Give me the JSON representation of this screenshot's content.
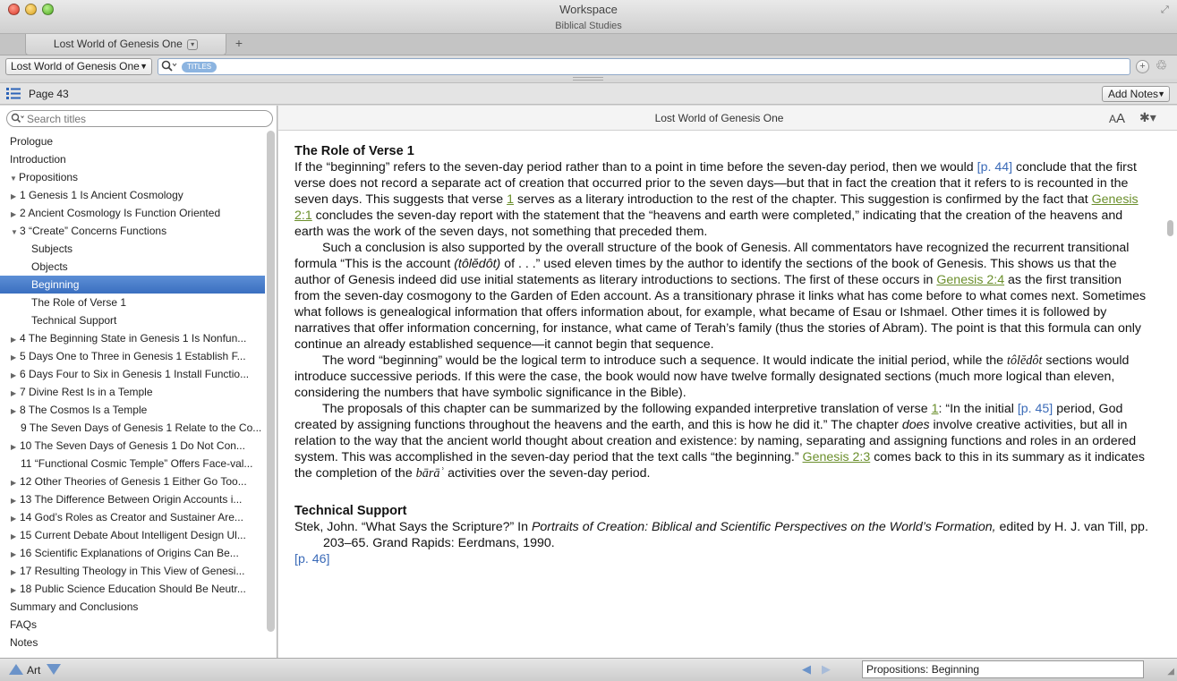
{
  "window": {
    "title": "Workspace",
    "subtitle": "Biblical Studies"
  },
  "tabs": [
    {
      "label": "Lost World of Genesis One"
    }
  ],
  "toolbar": {
    "resource": "Lost World of Genesis One",
    "search_scope": "TITLES",
    "search_value": ""
  },
  "pagebar": {
    "page": "Page 43",
    "add_notes": "Add Notes"
  },
  "sidebar": {
    "search_placeholder": "Search titles",
    "items": [
      {
        "label": "Prologue",
        "level": 0,
        "expander": ""
      },
      {
        "label": "Introduction",
        "level": 0,
        "expander": ""
      },
      {
        "label": "Propositions",
        "level": 0,
        "expander": "open"
      },
      {
        "label": "1 Genesis 1 Is Ancient Cosmology",
        "level": 1,
        "expander": "closed"
      },
      {
        "label": "2 Ancient Cosmology Is Function Oriented",
        "level": 1,
        "expander": "closed"
      },
      {
        "label": "3 “Create” Concerns Functions",
        "level": 1,
        "expander": "open"
      },
      {
        "label": "Subjects",
        "level": 2,
        "expander": ""
      },
      {
        "label": "Objects",
        "level": 2,
        "expander": ""
      },
      {
        "label": "Beginning",
        "level": 2,
        "expander": "",
        "selected": true
      },
      {
        "label": "The Role of Verse 1",
        "level": 2,
        "expander": ""
      },
      {
        "label": "Technical Support",
        "level": 2,
        "expander": ""
      },
      {
        "label": "4 The Beginning State in Genesis 1 Is Nonfun...",
        "level": 1,
        "expander": "closed"
      },
      {
        "label": "5 Days One to Three in Genesis 1 Establish F...",
        "level": 1,
        "expander": "closed"
      },
      {
        "label": "6 Days Four to Six in Genesis 1 Install Functio...",
        "level": 1,
        "expander": "closed"
      },
      {
        "label": "7 Divine Rest Is in a Temple",
        "level": 1,
        "expander": "closed"
      },
      {
        "label": "8 The Cosmos Is a Temple",
        "level": 1,
        "expander": "closed"
      },
      {
        "label": "9 The Seven Days of Genesis 1 Relate to the Co...",
        "level": 1,
        "expander": "none"
      },
      {
        "label": "10 The Seven Days of Genesis 1 Do Not Con...",
        "level": 1,
        "expander": "closed"
      },
      {
        "label": "11 “Functional Cosmic Temple” Offers Face-val...",
        "level": 1,
        "expander": "none"
      },
      {
        "label": "12 Other Theories of Genesis 1 Either Go Too...",
        "level": 1,
        "expander": "closed"
      },
      {
        "label": "13 The Difference Between Origin Accounts i...",
        "level": 1,
        "expander": "closed"
      },
      {
        "label": "14 God’s Roles as Creator and Sustainer Are...",
        "level": 1,
        "expander": "closed"
      },
      {
        "label": "15 Current Debate About Intelligent Design Ul...",
        "level": 1,
        "expander": "closed"
      },
      {
        "label": "16 Scientific Explanations of Origins Can Be...",
        "level": 1,
        "expander": "closed"
      },
      {
        "label": "17 Resulting Theology in This View of Genesi...",
        "level": 1,
        "expander": "closed"
      },
      {
        "label": "18 Public Science Education Should Be Neutr...",
        "level": 1,
        "expander": "closed"
      },
      {
        "label": "Summary and Conclusions",
        "level": 0,
        "expander": ""
      },
      {
        "label": "FAQs",
        "level": 0,
        "expander": ""
      },
      {
        "label": "Notes",
        "level": 0,
        "expander": ""
      }
    ]
  },
  "reader": {
    "title": "Lost World of Genesis One",
    "font_icon_small": "A",
    "font_icon_large": "A",
    "heading1": "The Role of Verse 1",
    "heading2": "Technical Support",
    "p1": {
      "a": "If the “beginning” refers to the seven-day period rather than to a point in time before the seven-day period, then we would ",
      "link_p44": "[p. 44]",
      "b": " conclude that the first verse does not record a separate act of creation that occurred prior to the seven days—but that in fact the creation that it refers to is recounted in the seven days. This suggests that verse ",
      "link_v1": "1",
      "c": " serves as a literary introduction to the rest of the chapter. This suggestion is confirmed by the fact that ",
      "link_gen21": "Genesis 2:1",
      "d": " concludes the seven-day report with the statement that the “heavens and earth were completed,” indicating that the creation of the heavens and earth was the work of the seven days, not something that preceded them."
    },
    "p2": {
      "a": "Such a conclusion is also supported by the overall structure of the book of Genesis. All commentators have recognized the recurrent transitional formula “This is the account ",
      "term": "(tôlĕdôt)",
      "b": " of . . .” used eleven times by the author to identify the sections of the book of Genesis. This shows us that the author of Genesis indeed did use initial statements as literary introductions to sections. The first of these occurs in ",
      "link_gen24": "Genesis 2:4",
      "c": " as the first transition from the seven-day cosmogony to the Garden of Eden account. As a transitionary phrase it links what has come before to what comes next. Sometimes what follows is genealogical information that offers information about, for example, what became of Esau or Ishmael. Other times it is followed by narratives that offer information concerning, for instance, what came of Terah’s family (thus the stories of Abram). The point is that this formula can only continue an already established sequence—it cannot begin that sequence."
    },
    "p3": {
      "a": "The word “beginning” would be the logical term to introduce such a sequence. It would indicate the initial period, while the ",
      "term": "tôlĕdôt",
      "b": " sections would introduce successive periods. If this were the case, the book would now have twelve formally designated sections (much more logical than eleven, considering the numbers that have symbolic significance in the Bible)."
    },
    "p4": {
      "a": "The proposals of this chapter can be summarized by the following expanded interpretive translation of verse ",
      "link_v1": "1",
      "b": ": “In the initial ",
      "link_p45": "[p. 45]",
      "c": " period, God created by assigning functions throughout the heavens and the earth, and this is how he did it.” The chapter ",
      "em": "does",
      "d": " involve creative activities, but all in relation to the way that the ancient world thought about creation and existence: by naming, separating and assigning functions and roles in an ordered system. This was accomplished in the seven-day period that the text calls “the beginning.” ",
      "link_gen23": "Genesis 2:3",
      "e": " comes back to this in its summary as it indicates the completion of the ",
      "term": "bārāʾ",
      "f": " activities over the seven-day period."
    },
    "bibliography": {
      "a": "Stek, John. “What Says the Scripture?” In ",
      "title": "Portraits of Creation: Biblical and Scientific Perspectives on the World’s Formation,",
      "b": " edited by H. J. van Till, pp. 203–65. Grand Rapids: Eerdmans, 1990."
    },
    "page_marker": "[p. 46]"
  },
  "statusbar": {
    "art_label": "Art",
    "location": "Propositions: Beginning"
  }
}
